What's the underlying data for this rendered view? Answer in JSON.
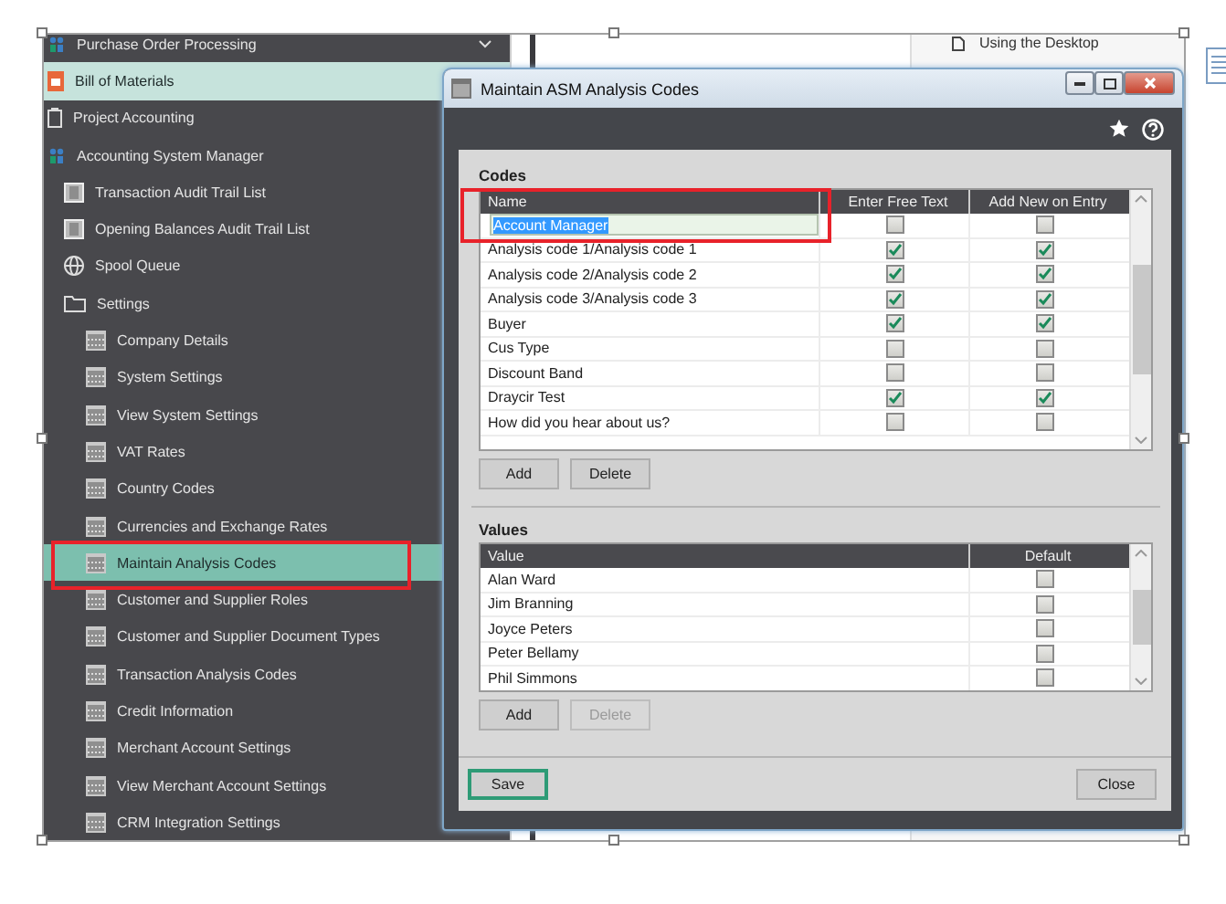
{
  "sidebar": {
    "items": [
      {
        "label": "Purchase Order Processing",
        "kind": "people",
        "selected": false,
        "hovered": false,
        "collapsible": true
      },
      {
        "label": "Bill of Materials",
        "kind": "bom",
        "selected": false,
        "hovered": true,
        "collapsible": false
      },
      {
        "label": "Project Accounting",
        "kind": "clipboard",
        "selected": false,
        "hovered": false,
        "collapsible": false
      },
      {
        "label": "Accounting System Manager",
        "kind": "people",
        "selected": false,
        "hovered": false,
        "collapsible": false,
        "children": [
          {
            "label": "Transaction Audit Trail List",
            "kind": "report",
            "selected": false,
            "hovered": false
          },
          {
            "label": "Opening Balances Audit Trail List",
            "kind": "report",
            "selected": false,
            "hovered": false
          },
          {
            "label": "Spool Queue",
            "kind": "globe",
            "selected": false,
            "hovered": false
          },
          {
            "label": "Settings",
            "kind": "folder",
            "selected": false,
            "hovered": false,
            "children": [
              {
                "label": "Company Details",
                "kind": "form",
                "selected": false,
                "hovered": false
              },
              {
                "label": "System Settings",
                "kind": "form",
                "selected": false,
                "hovered": false
              },
              {
                "label": "View System Settings",
                "kind": "form",
                "selected": false,
                "hovered": false
              },
              {
                "label": "VAT Rates",
                "kind": "form",
                "selected": false,
                "hovered": false
              },
              {
                "label": "Country Codes",
                "kind": "form",
                "selected": false,
                "hovered": false
              },
              {
                "label": "Currencies and Exchange Rates",
                "kind": "form",
                "selected": false,
                "hovered": false
              },
              {
                "label": "Maintain Analysis Codes",
                "kind": "form",
                "selected": true,
                "hovered": false
              },
              {
                "label": "Customer and Supplier Roles",
                "kind": "form",
                "selected": false,
                "hovered": false
              },
              {
                "label": "Customer and Supplier Document Types",
                "kind": "form",
                "selected": false,
                "hovered": false
              },
              {
                "label": "Transaction Analysis Codes",
                "kind": "form",
                "selected": false,
                "hovered": false
              },
              {
                "label": "Credit Information",
                "kind": "form",
                "selected": false,
                "hovered": false
              },
              {
                "label": "Merchant Account Settings",
                "kind": "form",
                "selected": false,
                "hovered": false
              },
              {
                "label": "View Merchant Account Settings",
                "kind": "form",
                "selected": false,
                "hovered": false
              },
              {
                "label": "CRM Integration Settings",
                "kind": "form",
                "selected": false,
                "hovered": false
              }
            ]
          }
        ]
      }
    ]
  },
  "help_panel": {
    "link": "Using the Desktop"
  },
  "dialog": {
    "title": "Maintain ASM Analysis Codes",
    "codes": {
      "heading": "Codes",
      "columns": [
        "Name",
        "Enter Free Text",
        "Add New on Entry"
      ],
      "rows": [
        {
          "name": "Account Manager",
          "editing": true,
          "free_text": false,
          "add_new": false
        },
        {
          "name": "Analysis code 1/Analysis code 1",
          "editing": false,
          "free_text": true,
          "add_new": true
        },
        {
          "name": "Analysis code 2/Analysis code 2",
          "editing": false,
          "free_text": true,
          "add_new": true
        },
        {
          "name": "Analysis code 3/Analysis code 3",
          "editing": false,
          "free_text": true,
          "add_new": true
        },
        {
          "name": "Buyer",
          "editing": false,
          "free_text": true,
          "add_new": true
        },
        {
          "name": "Cus Type",
          "editing": false,
          "free_text": false,
          "add_new": false
        },
        {
          "name": "Discount Band",
          "editing": false,
          "free_text": false,
          "add_new": false
        },
        {
          "name": "Draycir Test",
          "editing": false,
          "free_text": true,
          "add_new": true
        },
        {
          "name": "How did you hear about us?",
          "editing": false,
          "free_text": false,
          "add_new": false
        }
      ],
      "buttons": [
        {
          "label": "Add",
          "disabled": false
        },
        {
          "label": "Delete",
          "disabled": false
        }
      ]
    },
    "values": {
      "heading": "Values",
      "columns": [
        "Value",
        "Default"
      ],
      "rows": [
        {
          "value": "Alan Ward",
          "default": false
        },
        {
          "value": "Jim Branning",
          "default": false
        },
        {
          "value": "Joyce Peters",
          "default": false
        },
        {
          "value": "Peter Bellamy",
          "default": false
        },
        {
          "value": "Phil Simmons",
          "default": false
        }
      ],
      "buttons": [
        {
          "label": "Add",
          "disabled": false
        },
        {
          "label": "Delete",
          "disabled": true
        }
      ]
    },
    "footer": [
      {
        "label": "Save",
        "focused": true
      },
      {
        "label": "Close",
        "focused": false
      }
    ]
  }
}
